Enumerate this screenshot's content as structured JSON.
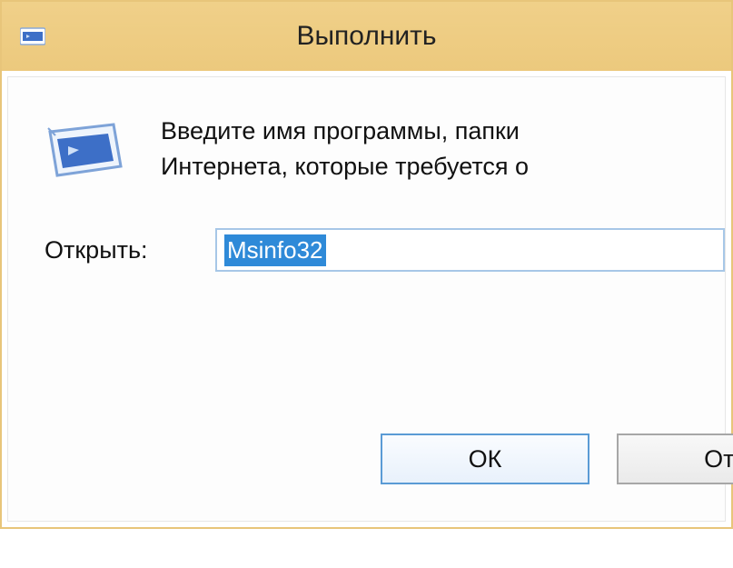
{
  "titlebar": {
    "title": "Выполнить"
  },
  "body": {
    "description_line1": "Введите имя программы, папки",
    "description_line2": "Интернета, которые требуется о",
    "open_label": "Открыть:",
    "input_value": "Msinfo32"
  },
  "buttons": {
    "ok": "ОК",
    "cancel": "Отм"
  }
}
